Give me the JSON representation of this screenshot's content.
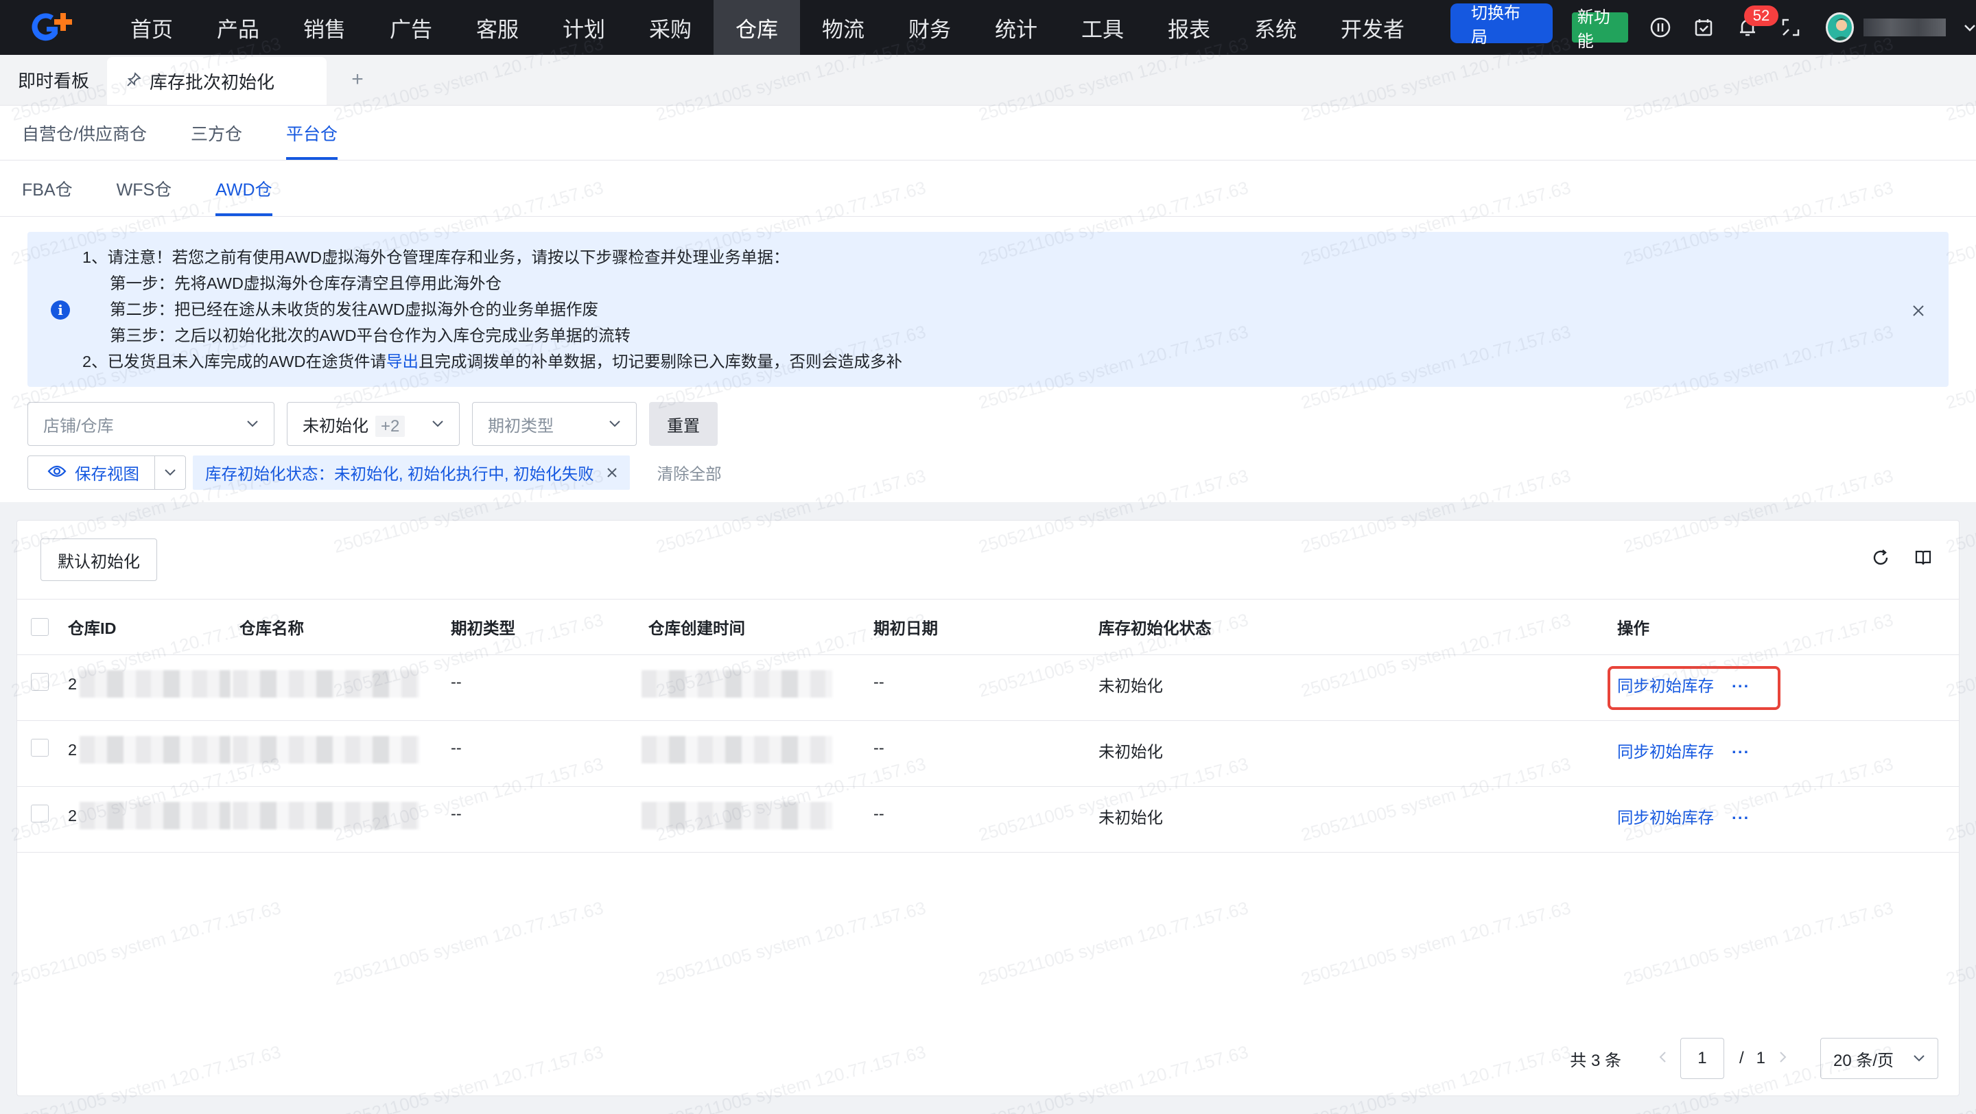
{
  "nav": {
    "items": [
      {
        "label": "首页",
        "name": "nav-item-home"
      },
      {
        "label": "产品",
        "name": "nav-item-product"
      },
      {
        "label": "销售",
        "name": "nav-item-sales"
      },
      {
        "label": "广告",
        "name": "nav-item-ads"
      },
      {
        "label": "客服",
        "name": "nav-item-service"
      },
      {
        "label": "计划",
        "name": "nav-item-plan"
      },
      {
        "label": "采购",
        "name": "nav-item-purchase"
      },
      {
        "label": "仓库",
        "name": "nav-item-warehouse",
        "active": true
      },
      {
        "label": "物流",
        "name": "nav-item-logistics"
      },
      {
        "label": "财务",
        "name": "nav-item-finance"
      },
      {
        "label": "统计",
        "name": "nav-item-stats"
      },
      {
        "label": "工具",
        "name": "nav-item-tools"
      },
      {
        "label": "报表",
        "name": "nav-item-reports"
      },
      {
        "label": "系统",
        "name": "nav-item-system"
      },
      {
        "label": "开发者",
        "name": "nav-item-developer"
      }
    ],
    "switch_layout": "切换布局",
    "new_feature": "新功能",
    "notifications_count": "52",
    "accent": "#1558e0"
  },
  "page_tabs": {
    "dashboard": "即时看板",
    "current": "库存批次初始化",
    "add": "+"
  },
  "warehouse_tabs": [
    "自营仓/供应商仓",
    "三方仓",
    "平台仓"
  ],
  "platform_tabs": [
    "FBA仓",
    "WFS仓",
    "AWD仓"
  ],
  "notice": {
    "line1": "1、请注意！若您之前有使用AWD虚拟海外仓管理库存和业务，请按以下步骤检查并处理业务单据：",
    "step1": "第一步：先将AWD虚拟海外仓库存清空且停用此海外仓",
    "step2": "第二步：把已经在途从未收货的发往AWD虚拟海外仓的业务单据作废",
    "step3": "第三步：之后以初始化批次的AWD平台仓作为入库仓完成业务单据的流转",
    "line2_a": "2、已发货且未入库完成的AWD在途货件请",
    "line2_link": "导出",
    "line2_b": "且完成调拨单的补单数据，切记要剔除已入库数量，否则会造成多补"
  },
  "filters": {
    "shop_placeholder": "店铺/仓库",
    "status_value": "未初始化",
    "status_more": "+2",
    "type_placeholder": "期初类型",
    "reset": "重置"
  },
  "view": {
    "save_view": "保存视图",
    "active_filter": "库存初始化状态：未初始化, 初始化执行中, 初始化失败",
    "clear_all": "清除全部"
  },
  "table": {
    "toolbar_button": "默认初始化",
    "columns": [
      "仓库ID",
      "仓库名称",
      "期初类型",
      "仓库创建时间",
      "期初日期",
      "库存初始化状态",
      "操作"
    ],
    "rows": [
      {
        "id_prefix": "2",
        "type": "--",
        "date": "--",
        "status": "未初始化",
        "action": "同步初始库存",
        "more": "···"
      },
      {
        "id_prefix": "2",
        "type": "--",
        "date": "--",
        "status": "未初始化",
        "action": "同步初始库存",
        "more": "···"
      },
      {
        "id_prefix": "2",
        "type": "--",
        "date": "--",
        "status": "未初始化",
        "action": "同步初始库存",
        "more": "···"
      }
    ]
  },
  "pagination": {
    "total": "共 3 条",
    "current_page": "1",
    "separator": "/",
    "total_pages": "1",
    "page_size": "20 条/页"
  },
  "watermark": "2505211005 system 120.77.157.63"
}
